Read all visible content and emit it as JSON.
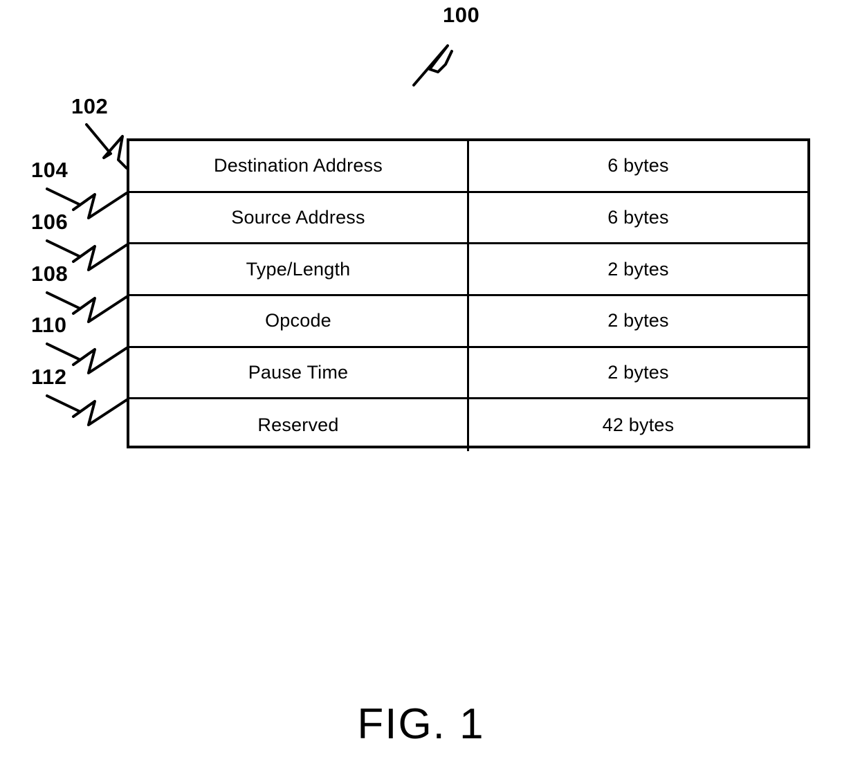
{
  "figure": {
    "number_label": "100",
    "caption": "FIG. 1"
  },
  "table": {
    "rows": [
      {
        "ref": "102",
        "name": "Destination Address",
        "size": "6 bytes"
      },
      {
        "ref": "104",
        "name": "Source Address",
        "size": "6 bytes"
      },
      {
        "ref": "106",
        "name": "Type/Length",
        "size": "2 bytes"
      },
      {
        "ref": "108",
        "name": "Opcode",
        "size": "2 bytes"
      },
      {
        "ref": "110",
        "name": "Pause Time",
        "size": "2 bytes"
      },
      {
        "ref": "112",
        "name": "Reserved",
        "size": "42 bytes"
      }
    ]
  },
  "reference_numerals": {
    "r100": "100",
    "r102": "102",
    "r104": "104",
    "r106": "106",
    "r108": "108",
    "r110": "110",
    "r112": "112"
  },
  "colors": {
    "ink": "#000000",
    "background": "#ffffff"
  }
}
